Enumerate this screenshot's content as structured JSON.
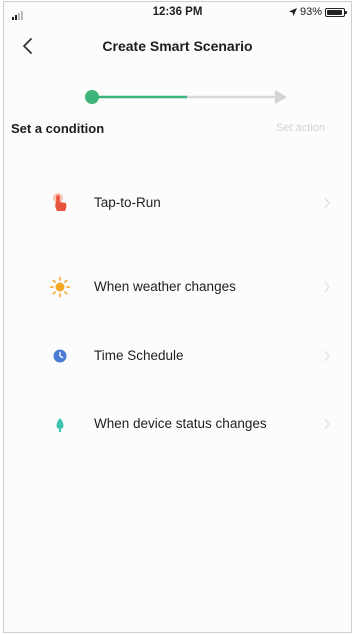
{
  "status_bar": {
    "time": "12:36 PM",
    "battery": "93%"
  },
  "header": {
    "title": "Create Smart Scenario"
  },
  "stepper": {
    "step1": "Set a condition",
    "step2": "Set action"
  },
  "options": [
    {
      "label": "Tap-to-Run",
      "icon": "tap-icon",
      "color": "#e8553c"
    },
    {
      "label": "When weather changes",
      "icon": "sun-icon",
      "color": "#f5a623"
    },
    {
      "label": "Time Schedule",
      "icon": "clock-icon",
      "color": "#4a7bd6"
    },
    {
      "label": "When device status changes",
      "icon": "device-icon",
      "color": "#3fc3b0"
    }
  ],
  "colors": {
    "accent": "#3cb47a",
    "inactive": "#d8d8d8"
  }
}
